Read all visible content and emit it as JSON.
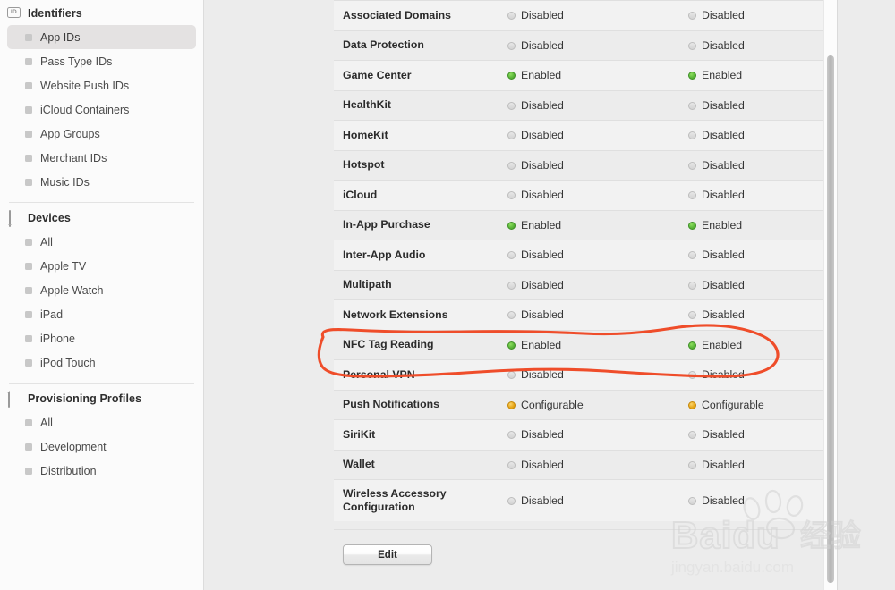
{
  "sidebar": {
    "groups": [
      {
        "title": "Identifiers",
        "icon": "id-card-icon",
        "items": [
          {
            "label": "App IDs",
            "selected": true
          },
          {
            "label": "Pass Type IDs",
            "selected": false
          },
          {
            "label": "Website Push IDs",
            "selected": false
          },
          {
            "label": "iCloud Containers",
            "selected": false
          },
          {
            "label": "App Groups",
            "selected": false
          },
          {
            "label": "Merchant IDs",
            "selected": false
          },
          {
            "label": "Music IDs",
            "selected": false
          }
        ]
      },
      {
        "title": "Devices",
        "icon": "device-icon",
        "items": [
          {
            "label": "All",
            "selected": false
          },
          {
            "label": "Apple TV",
            "selected": false
          },
          {
            "label": "Apple Watch",
            "selected": false
          },
          {
            "label": "iPad",
            "selected": false
          },
          {
            "label": "iPhone",
            "selected": false
          },
          {
            "label": "iPod Touch",
            "selected": false
          }
        ]
      },
      {
        "title": "Provisioning Profiles",
        "icon": "document-icon",
        "items": [
          {
            "label": "All",
            "selected": false
          },
          {
            "label": "Development",
            "selected": false
          },
          {
            "label": "Distribution",
            "selected": false
          }
        ]
      }
    ]
  },
  "capabilities_table": {
    "rows": [
      {
        "name": "Associated Domains",
        "col1": "Disabled",
        "col2": "Disabled",
        "state1": "disabled",
        "state2": "disabled"
      },
      {
        "name": "Data Protection",
        "col1": "Disabled",
        "col2": "Disabled",
        "state1": "disabled",
        "state2": "disabled"
      },
      {
        "name": "Game Center",
        "col1": "Enabled",
        "col2": "Enabled",
        "state1": "enabled",
        "state2": "enabled"
      },
      {
        "name": "HealthKit",
        "col1": "Disabled",
        "col2": "Disabled",
        "state1": "disabled",
        "state2": "disabled"
      },
      {
        "name": "HomeKit",
        "col1": "Disabled",
        "col2": "Disabled",
        "state1": "disabled",
        "state2": "disabled"
      },
      {
        "name": "Hotspot",
        "col1": "Disabled",
        "col2": "Disabled",
        "state1": "disabled",
        "state2": "disabled"
      },
      {
        "name": "iCloud",
        "col1": "Disabled",
        "col2": "Disabled",
        "state1": "disabled",
        "state2": "disabled"
      },
      {
        "name": "In-App Purchase",
        "col1": "Enabled",
        "col2": "Enabled",
        "state1": "enabled",
        "state2": "enabled"
      },
      {
        "name": "Inter-App Audio",
        "col1": "Disabled",
        "col2": "Disabled",
        "state1": "disabled",
        "state2": "disabled"
      },
      {
        "name": "Multipath",
        "col1": "Disabled",
        "col2": "Disabled",
        "state1": "disabled",
        "state2": "disabled"
      },
      {
        "name": "Network Extensions",
        "col1": "Disabled",
        "col2": "Disabled",
        "state1": "disabled",
        "state2": "disabled"
      },
      {
        "name": "NFC Tag Reading",
        "col1": "Enabled",
        "col2": "Enabled",
        "state1": "enabled",
        "state2": "enabled",
        "highlighted": true
      },
      {
        "name": "Personal VPN",
        "col1": "Disabled",
        "col2": "Disabled",
        "state1": "disabled",
        "state2": "disabled"
      },
      {
        "name": "Push Notifications",
        "col1": "Configurable",
        "col2": "Configurable",
        "state1": "configurable",
        "state2": "configurable"
      },
      {
        "name": "SiriKit",
        "col1": "Disabled",
        "col2": "Disabled",
        "state1": "disabled",
        "state2": "disabled"
      },
      {
        "name": "Wallet",
        "col1": "Disabled",
        "col2": "Disabled",
        "state1": "disabled",
        "state2": "disabled"
      },
      {
        "name": "Wireless Accessory Configuration",
        "col1": "Disabled",
        "col2": "Disabled",
        "state1": "disabled",
        "state2": "disabled",
        "two_line": true
      }
    ]
  },
  "toolbar": {
    "edit_label": "Edit"
  },
  "annotation": {
    "target_row": "NFC Tag Reading",
    "color": "#ef4d2a",
    "shape": "hand-drawn-oval"
  },
  "watermark": {
    "brand": "Baidu",
    "suffix": "经验",
    "url": "jingyan.baidu.com"
  },
  "colors": {
    "enabled": "#5cb83a",
    "disabled": "#d3d3d3",
    "configurable": "#e8a81a",
    "sidebar_bg": "#fbfbfb",
    "content_bg": "#ececec",
    "selected_bg": "#e4e2e2",
    "annotation_red": "#ef4d2a"
  }
}
